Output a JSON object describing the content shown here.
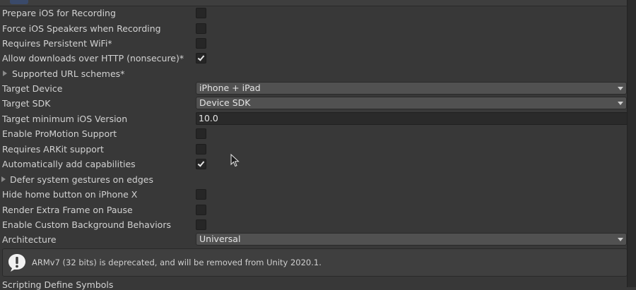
{
  "settings": {
    "prepare_ios_recording": {
      "label": "Prepare iOS for Recording",
      "checked": false
    },
    "force_ios_speakers": {
      "label": "Force iOS Speakers when Recording",
      "checked": false
    },
    "requires_persistent_wifi": {
      "label": "Requires Persistent WiFi*",
      "checked": false
    },
    "allow_http_downloads": {
      "label": "Allow downloads over HTTP (nonsecure)*",
      "checked": true
    },
    "supported_url_schemes": {
      "label": "Supported URL schemes*",
      "expanded": false
    },
    "target_device": {
      "label": "Target Device",
      "value": "iPhone + iPad"
    },
    "target_sdk": {
      "label": "Target SDK",
      "value": "Device SDK"
    },
    "target_min_ios": {
      "label": "Target minimum iOS Version",
      "value": "10.0"
    },
    "enable_promotion": {
      "label": "Enable ProMotion Support",
      "checked": false
    },
    "requires_arkit": {
      "label": "Requires ARKit support",
      "checked": false
    },
    "auto_add_capabilities": {
      "label": "Automatically add capabilities",
      "checked": true
    },
    "defer_gestures": {
      "label": "Defer system gestures on edges",
      "expanded": false
    },
    "hide_home_button": {
      "label": "Hide home button on iPhone X",
      "checked": false
    },
    "render_extra_frame": {
      "label": "Render Extra Frame on Pause",
      "checked": false
    },
    "custom_background": {
      "label": "Enable Custom Background Behaviors",
      "checked": false
    },
    "architecture": {
      "label": "Architecture",
      "value": "Universal"
    }
  },
  "warning": {
    "icon": "exclamation-icon",
    "message": "ARMv7 (32 bits) is deprecated, and will be removed from Unity 2020.1."
  },
  "next_section_label": "Scripting Define Symbols",
  "colors": {
    "background": "#383838",
    "dropdown": "#515151",
    "field": "#2a2a2a",
    "text": "#d2d2d2"
  }
}
